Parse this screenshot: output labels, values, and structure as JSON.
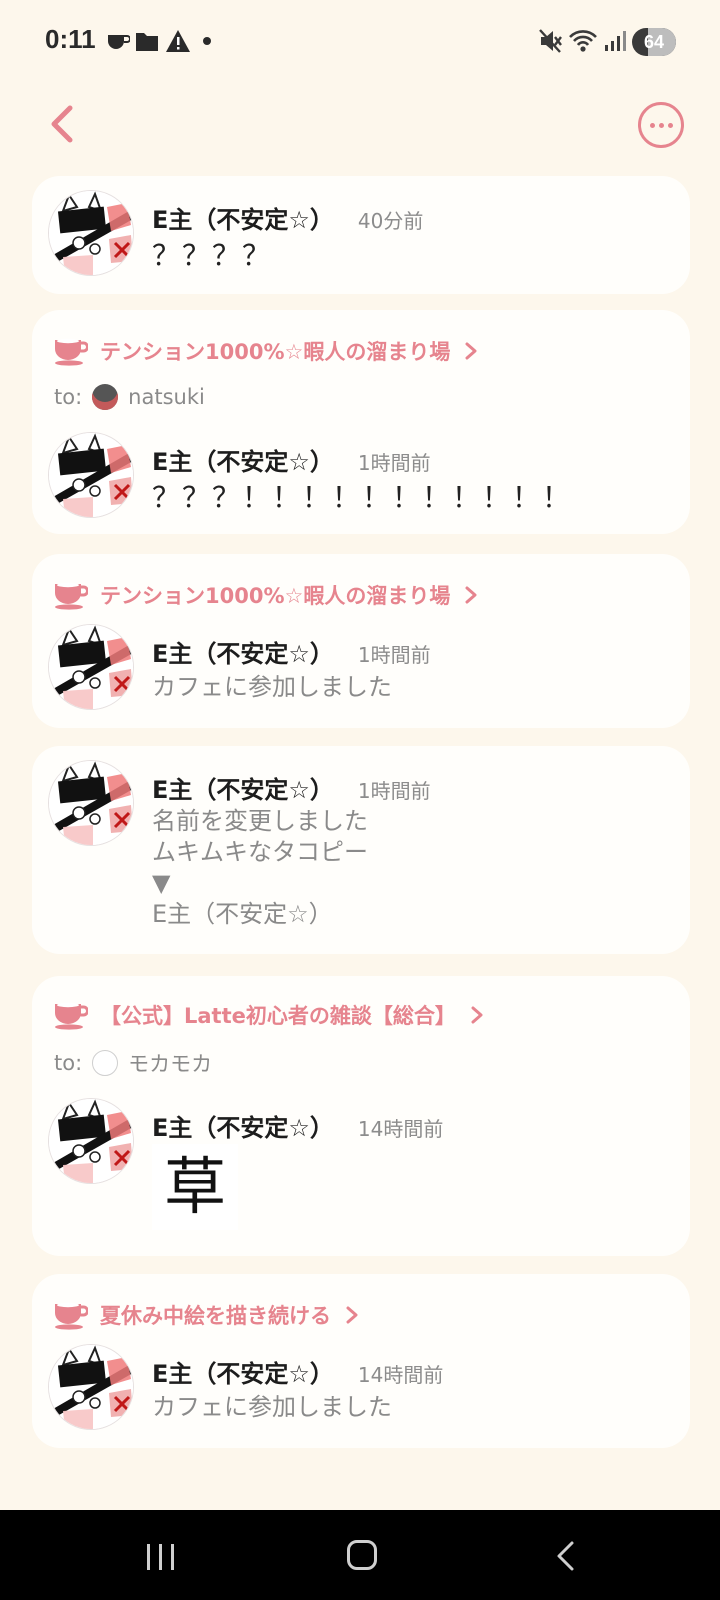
{
  "status_bar": {
    "time": "0:11",
    "battery": "64",
    "battery_level": 0.64,
    "icons": [
      "cup-icon",
      "folder-icon",
      "warning-icon",
      "dot-icon",
      "mute-icon",
      "wifi-icon",
      "signal-icon"
    ]
  },
  "header": {
    "back_icon": "chevron-left-icon",
    "more_icon": "more-horizontal-icon"
  },
  "colors": {
    "accent": "#e6848e",
    "background": "#fdf7ec",
    "card": "#fffefb"
  },
  "feed": [
    {
      "user": "E主（不安定☆）",
      "time": "40分前",
      "message": "？？？？"
    },
    {
      "room": "テンション1000%☆暇人の溜まり場",
      "to_label": "to:",
      "to_user": "natsuki",
      "user": "E主（不安定☆）",
      "time": "1時間前",
      "message": "？？？！！！！！！！！！！！"
    },
    {
      "room": "テンション1000%☆暇人の溜まり場",
      "user": "E主（不安定☆）",
      "time": "1時間前",
      "system": "カフェに参加しました"
    },
    {
      "user": "E主（不安定☆）",
      "time": "1時間前",
      "system_lines": [
        "名前を変更しました",
        "ムキムキなタコピー",
        "▼",
        "E主（不安定☆）"
      ]
    },
    {
      "room": "【公式】Latte初心者の雑談【総合】",
      "to_label": "to:",
      "to_user": "モカモカ",
      "user": "E主（不安定☆）",
      "time": "14時間前",
      "stamp": "草"
    },
    {
      "room": "夏休み中絵を描き続ける",
      "user": "E主（不安定☆）",
      "time": "14時間前",
      "system": "カフェに参加しました"
    }
  ],
  "nav": {
    "recent_icon": "recent-apps-icon",
    "home_icon": "home-icon",
    "back_icon": "back-icon"
  }
}
